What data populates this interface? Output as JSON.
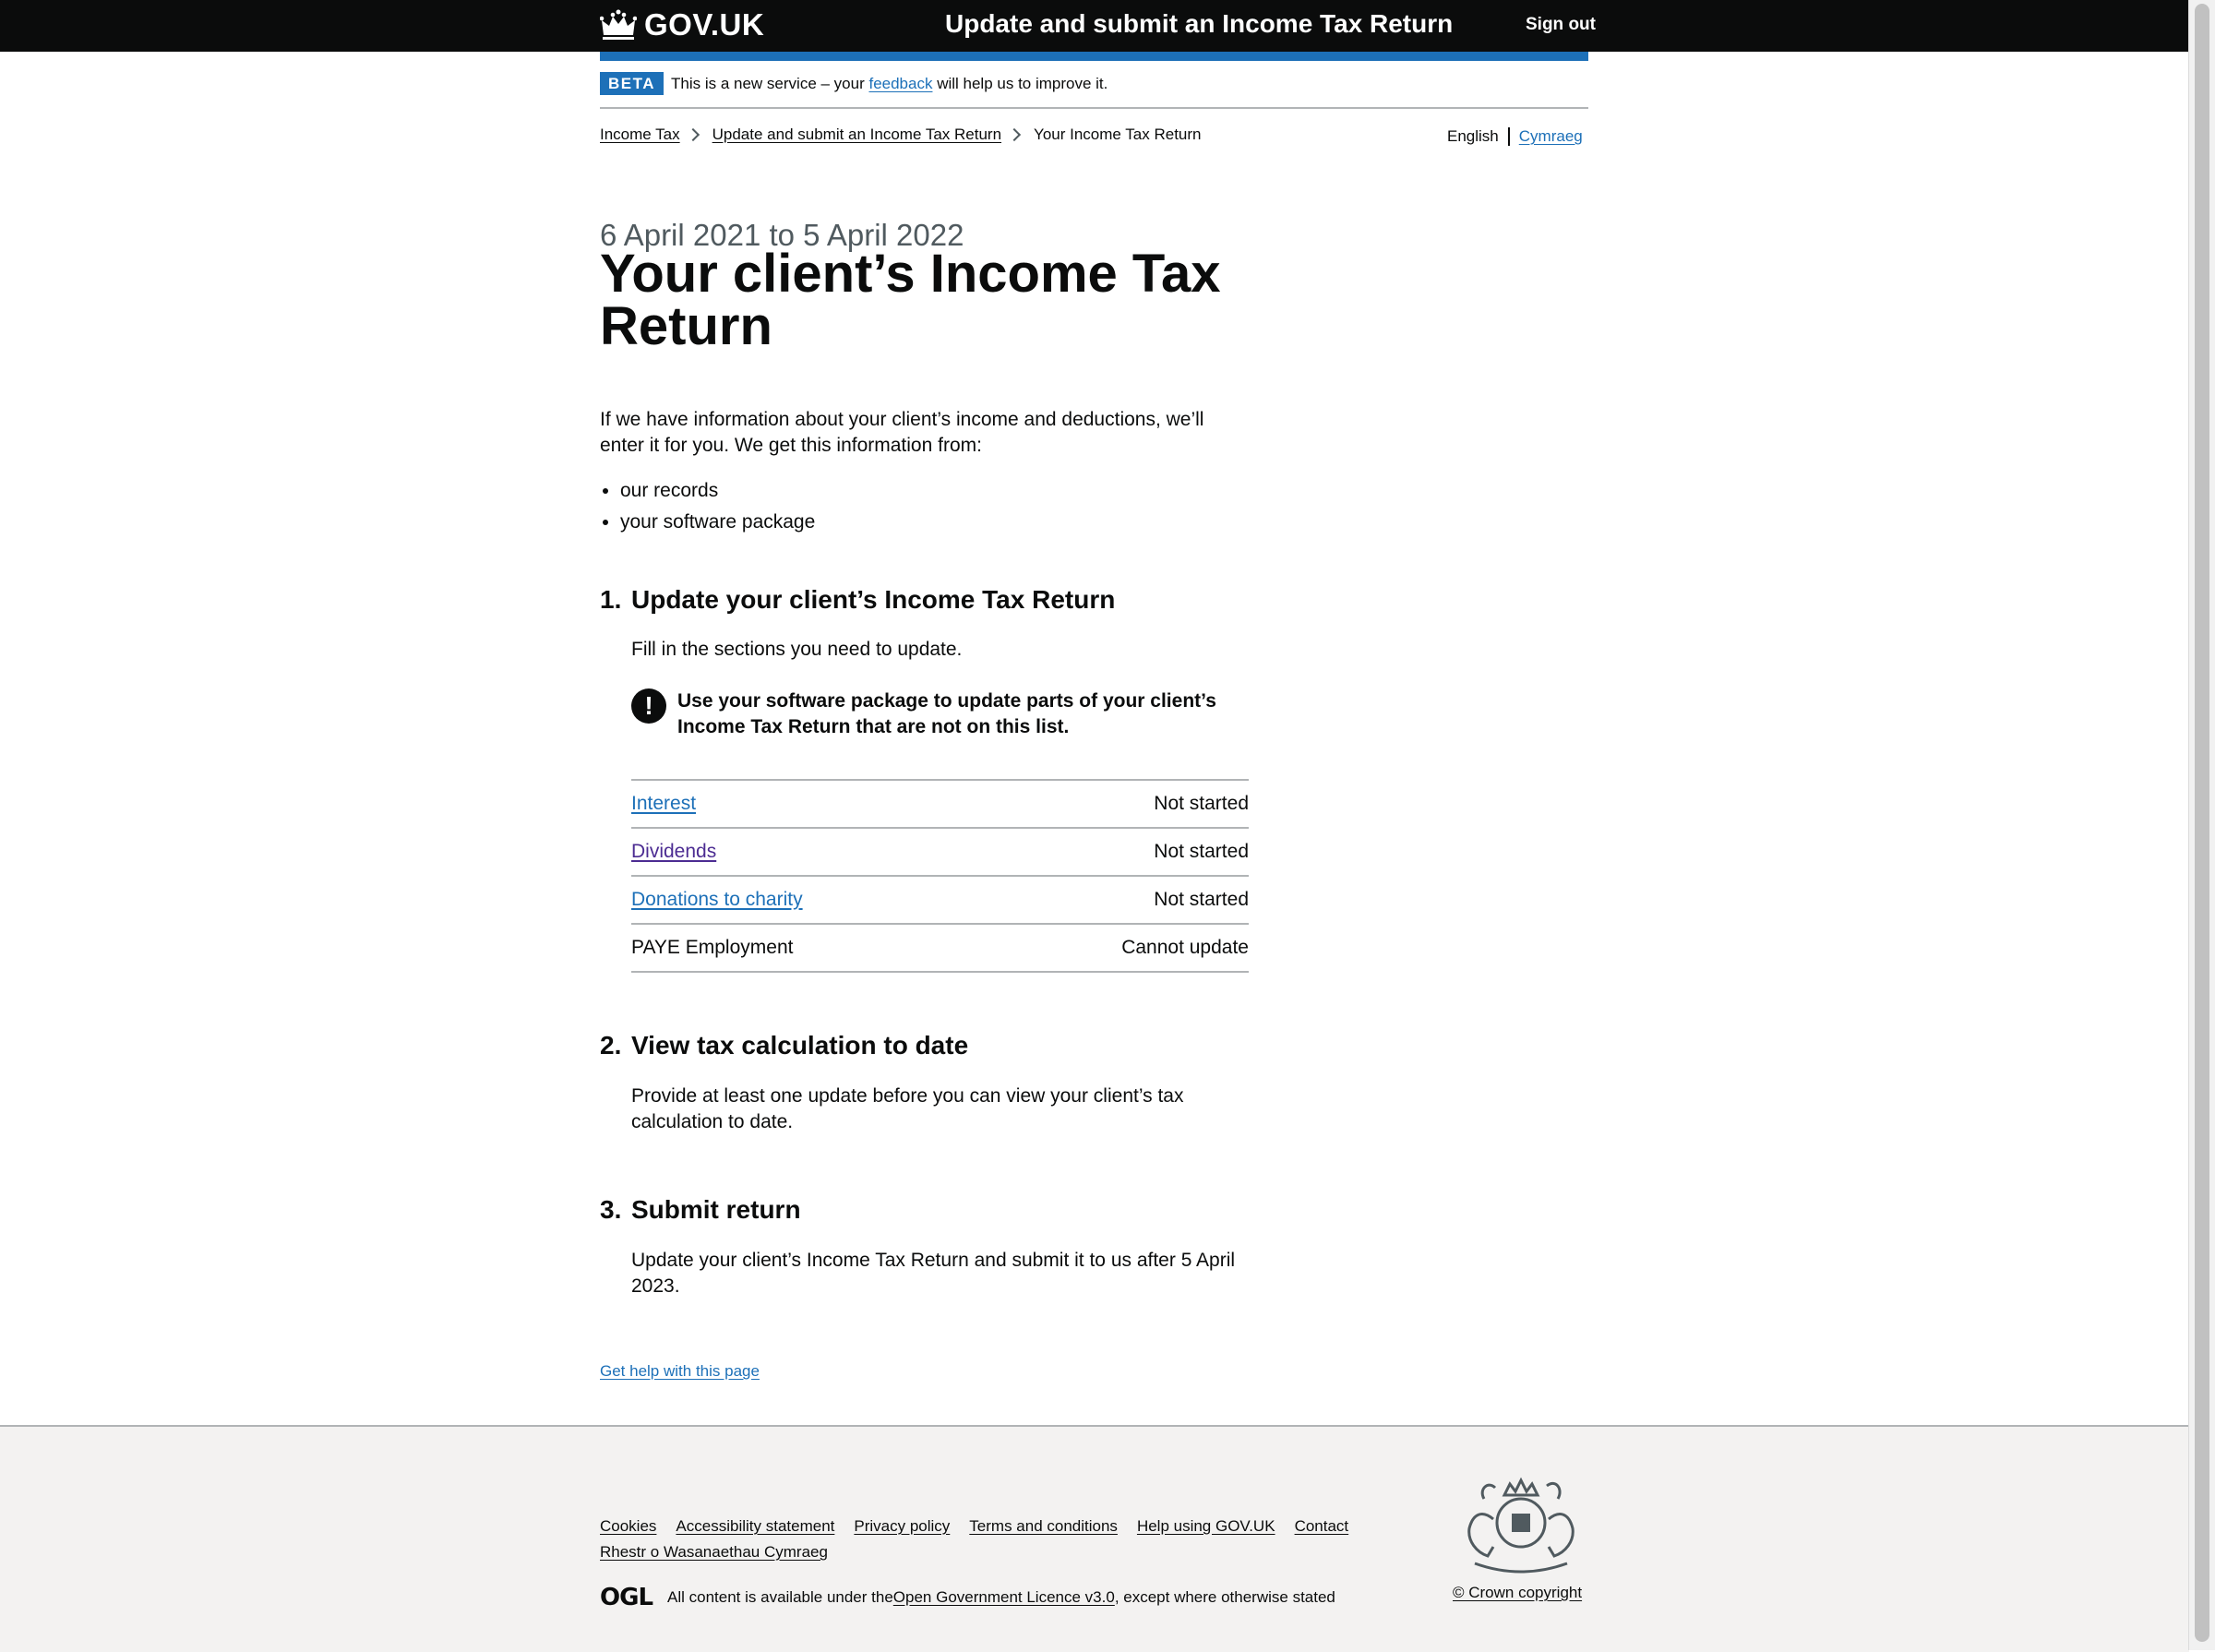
{
  "header": {
    "logo_text": "GOV.UK",
    "service_name": "Update and submit an Income Tax Return",
    "sign_out": "Sign out"
  },
  "phase_banner": {
    "tag": "BETA",
    "text_before": "This is a new service – your ",
    "link": "feedback",
    "text_after": " will help us to improve it."
  },
  "breadcrumbs": [
    "Income Tax",
    "Update and submit an Income Tax Return",
    "Your Income Tax Return"
  ],
  "language": {
    "current": "English",
    "other": "Cymraeg"
  },
  "page": {
    "caption": "6 April 2021 to 5 April 2022",
    "title": "Your client’s Income Tax Return",
    "intro": "If we have information about your client’s income and deductions, we’ll enter it for you. We get this information from:",
    "bullets": [
      "our records",
      "your software package"
    ]
  },
  "steps": [
    {
      "number": "1.",
      "title": "Update your client’s Income Tax Return",
      "text": "Fill in the sections you need to update."
    },
    {
      "number": "2.",
      "title": "View tax calculation to date",
      "text": "Provide at least one update before you can view your client’s tax calculation to date."
    },
    {
      "number": "3.",
      "title": "Submit return",
      "text": "Update your client’s Income Tax Return and submit it to us after 5 April 2023."
    }
  ],
  "warning": {
    "icon": "!",
    "text": "Use your software package to update parts of your client’s Income Tax Return that are not on this list."
  },
  "tasks": [
    {
      "name": "Interest",
      "status": "Not started"
    },
    {
      "name": "Dividends",
      "status": "Not started"
    },
    {
      "name": "Donations to charity",
      "status": "Not started"
    },
    {
      "name": "PAYE Employment",
      "status": "Cannot update"
    }
  ],
  "help_link": "Get help with this page",
  "footer": {
    "links": [
      "Cookies",
      "Accessibility statement",
      "Privacy policy",
      "Terms and conditions",
      "Help using GOV.UK",
      "Contact"
    ],
    "welsh_link": "Rhestr o Wasanaethau Cymraeg",
    "ogl_logo": "OGL",
    "licence_before": "All content is available under the ",
    "licence_link": "Open Government Licence v3.0",
    "licence_after": ", except where otherwise stated",
    "copyright": "© Crown copyright"
  },
  "colors": {
    "header_bg": "#0b0c0c",
    "brand_blue": "#1d70b8",
    "link": "#1d70b8",
    "visited_link": "#4c2c92",
    "footer_bg": "#f3f2f1"
  }
}
